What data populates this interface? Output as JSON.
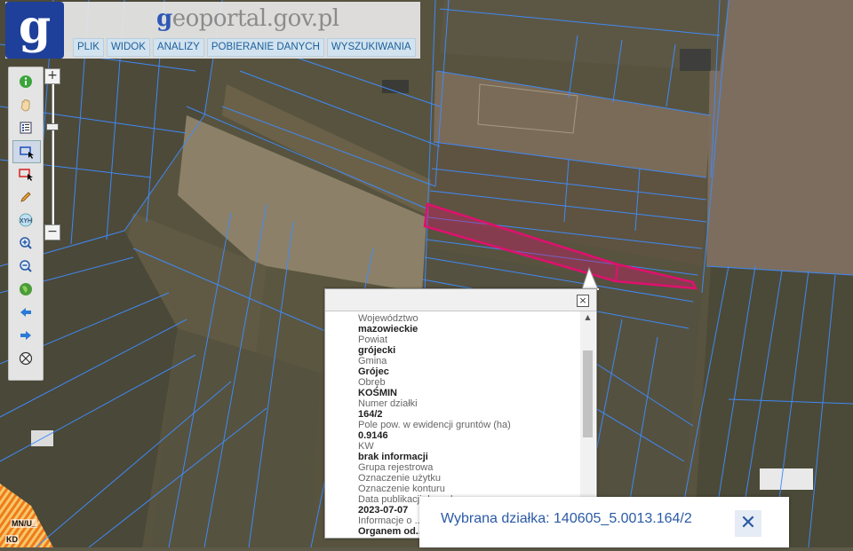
{
  "header": {
    "brand_prefix": "g",
    "brand_rest": "eoportal.gov.pl",
    "logo_letter": "g",
    "menu": [
      {
        "label": "PLIK"
      },
      {
        "label": "WIDOK"
      },
      {
        "label": "ANALIZY"
      },
      {
        "label": "POBIERANIE DANYCH"
      },
      {
        "label": "WYSZUKIWANIA"
      }
    ]
  },
  "toolbar": {
    "tools": [
      {
        "icon": "info-icon"
      },
      {
        "icon": "pan-hand-icon"
      },
      {
        "icon": "legend-icon"
      },
      {
        "icon": "select-rectangle-icon"
      },
      {
        "icon": "select-delete-icon"
      },
      {
        "icon": "pencil-icon"
      },
      {
        "icon": "xyh-icon",
        "label": "XYH"
      },
      {
        "icon": "zoom-in-icon"
      },
      {
        "icon": "zoom-out-icon"
      },
      {
        "icon": "globe-icon"
      },
      {
        "icon": "arrow-back-icon"
      },
      {
        "icon": "arrow-forward-icon"
      },
      {
        "icon": "crosshair-icon"
      }
    ],
    "zoom_plus": "+",
    "zoom_minus": "−"
  },
  "popup": {
    "close_label": "×",
    "attributes": [
      {
        "label": "Województwo",
        "value": "mazowieckie"
      },
      {
        "label": "Powiat",
        "value": "grójecki"
      },
      {
        "label": "Gmina",
        "value": "Grójec"
      },
      {
        "label": "Obręb",
        "value": "KOŚMIN"
      },
      {
        "label": "Numer działki",
        "value": "164/2"
      },
      {
        "label": "Pole pow. w ewidencji gruntów (ha)",
        "value": "0.9146"
      },
      {
        "label": "KW",
        "value": "brak informacji"
      },
      {
        "label": "Grupa rejestrowa",
        "value": ""
      },
      {
        "label": "Oznaczenie użytku",
        "value": ""
      },
      {
        "label": "Oznaczenie konturu",
        "value": ""
      },
      {
        "label": "Data publikacji danych",
        "value": "2023-07-07"
      },
      {
        "label": "Informacje o ...",
        "value": "Organem od..."
      }
    ]
  },
  "selection": {
    "text": "Wybrana działka: 140605_5.0013.164/2",
    "close_label": "✕"
  },
  "map": {
    "zone_labels": [
      "MN/U_",
      "KD"
    ],
    "highlight_color": "#e0106e",
    "parcel_line_color": "#3f8cff"
  }
}
